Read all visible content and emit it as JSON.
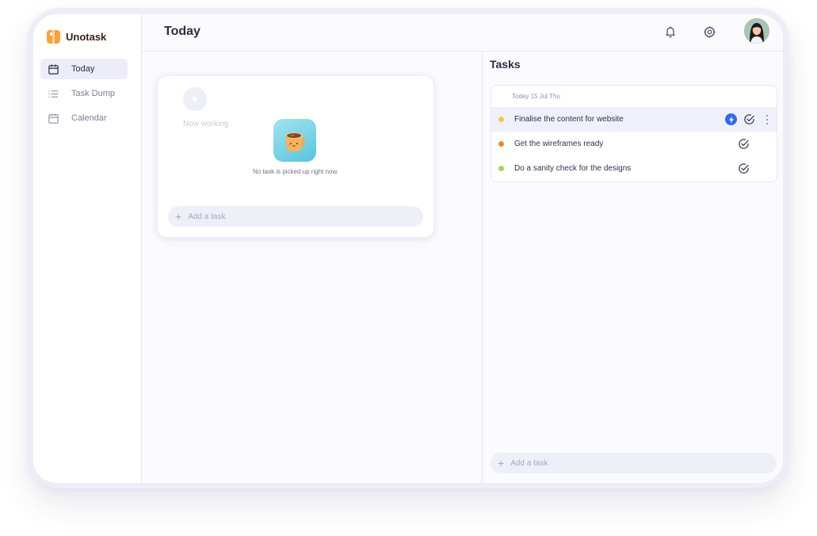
{
  "app": {
    "name": "Unotask"
  },
  "sidebar": {
    "items": [
      {
        "label": "Today",
        "icon": "calendar-icon",
        "active": true
      },
      {
        "label": "Task Dump",
        "icon": "list-icon",
        "active": false
      },
      {
        "label": "Calendar",
        "icon": "calendar-icon",
        "active": false
      }
    ]
  },
  "header": {
    "title": "Today",
    "icons": [
      "bell-icon",
      "gear-icon"
    ],
    "avatar": "user-avatar"
  },
  "now_working": {
    "label": "Now working",
    "empty_message": "No task is picked up right now.",
    "add_placeholder": "Add a task"
  },
  "tasks": {
    "title": "Tasks",
    "date_label": "Today 15 Jul Thu",
    "items": [
      {
        "text": "Finalise the content for website",
        "dot_color": "#f2c94c",
        "highlighted": true
      },
      {
        "text": "Get the wireframes ready",
        "dot_color": "#f2852c",
        "highlighted": false
      },
      {
        "text": "Do a sanity check for the designs",
        "dot_color": "#a6d35a",
        "highlighted": false
      }
    ],
    "add_placeholder": "Add a task"
  },
  "colors": {
    "accent": "#2f6bea",
    "brand": "#f7a23b",
    "active_nav_bg": "#ecedf8"
  }
}
